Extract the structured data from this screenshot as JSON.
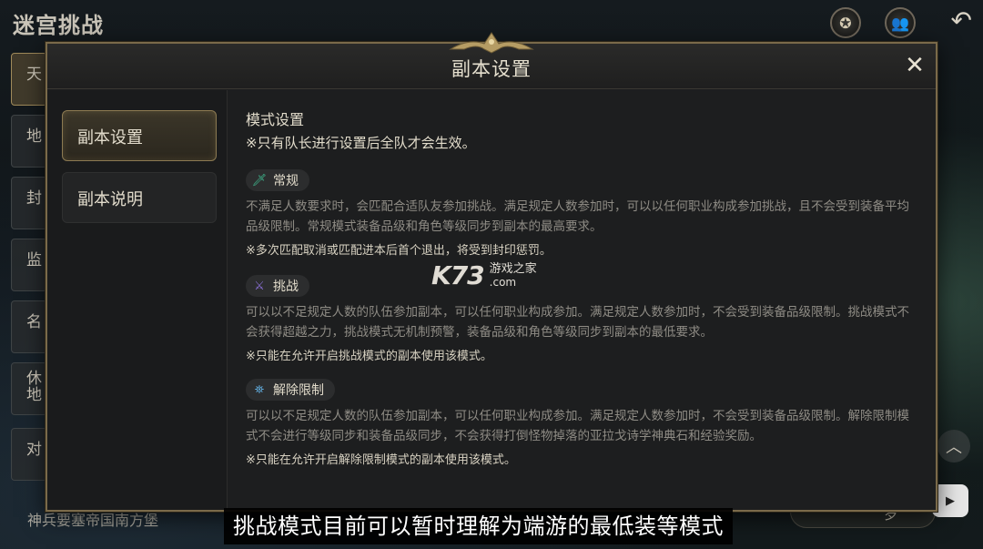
{
  "background": {
    "title": "迷宫挑战",
    "list_items": [
      "天",
      "地",
      "封",
      "监",
      "名",
      "休\n地",
      "对"
    ],
    "bottom_text": "神兵要塞帝国南方堡",
    "right_button_label": "岁",
    "icons": {
      "top_icon_1": "medal-icon",
      "top_icon_2": "group-icon",
      "back": "back-arrow-icon"
    }
  },
  "modal": {
    "title": "副本设置",
    "tabs": [
      {
        "label": "副本设置",
        "active": true
      },
      {
        "label": "副本说明",
        "active": false
      }
    ],
    "content": {
      "section_title": "模式设置",
      "notice": "※只有队长进行设置后全队才会生效。",
      "modes": [
        {
          "name": "常规",
          "icon": "sword-icon",
          "icon_color": "#3fb98f",
          "description": "不满足人数要求时，会匹配合适队友参加挑战。满足规定人数参加时，可以以任何职业构成参加挑战，且不会受到装备平均品级限制。常规模式装备品级和角色等级同步到副本的最高要求。",
          "note": "※多次匹配取消或匹配进本后首个退出，将受到封印惩罚。"
        },
        {
          "name": "挑战",
          "icon": "crossed-swords-icon",
          "icon_color": "#8a6fd6",
          "description": "可以以不足规定人数的队伍参加副本，可以任何职业构成参加。满足规定人数参加时，不会受到装备品级限制。挑战模式不会获得超越之力，挑战模式无机制预警，装备品级和角色等级同步到副本的最低要求。",
          "note": "※只能在允许开启挑战模式的副本使用该模式。"
        },
        {
          "name": "解除限制",
          "icon": "unlock-party-icon",
          "icon_color": "#5fa8d8",
          "description": "可以以不足规定人数的队伍参加副本，可以任何职业构成参加。满足规定人数参加时，不会受到装备品级限制。解除限制模式不会进行等级同步和装备品级同步，不会获得打倒怪物掉落的亚拉戈诗学神典石和经验奖励。",
          "note": "※只能在允许开启解除限制模式的副本使用该模式。"
        }
      ]
    }
  },
  "watermark": {
    "brand": "K73",
    "cn": "游戏之家",
    "domain": ".com"
  },
  "subtitle": "挑战模式目前可以暂时理解为端游的最低装等模式",
  "colors": {
    "gold_border": "#7a6a4a",
    "panel_bg": "#1d1e1f",
    "text_main": "#e2dccb",
    "text_dim": "#8f8c85"
  }
}
